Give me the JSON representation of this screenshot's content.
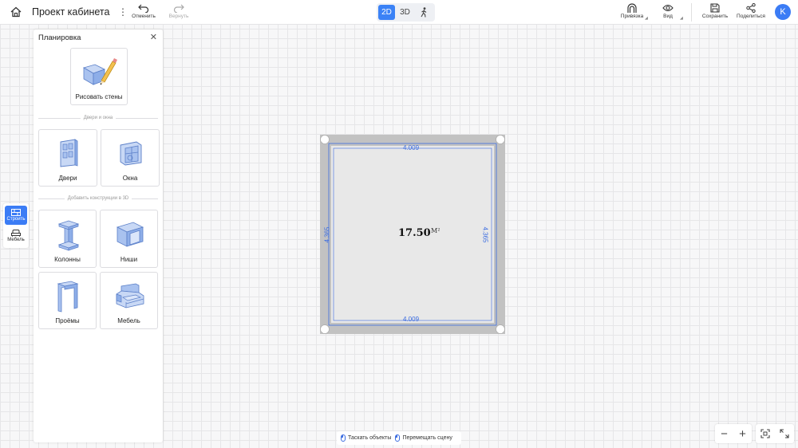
{
  "header": {
    "project_title": "Проект кабинета",
    "undo_label": "Отменить",
    "redo_label": "Вернуть",
    "modes": [
      "2D",
      "3D"
    ],
    "active_mode": "2D",
    "snap_label": "Привязка",
    "view_label": "Вид",
    "save_label": "Сохранить",
    "share_label": "Поделиться",
    "avatar_letter": "K",
    "accent_color": "#3b82f6"
  },
  "left_rail": {
    "build_label": "Строить",
    "furniture_label": "Мебель"
  },
  "panel": {
    "title": "Планировка",
    "draw_walls_label": "Рисовать стены",
    "doors_windows_header": "Двери и окна",
    "doors_label": "Двери",
    "windows_label": "Окна",
    "constructions_header": "Добавить конструкции в 3D",
    "columns_label": "Колонны",
    "niches_label": "Ниши",
    "openings_label": "Проёмы",
    "furniture_label": "Мебель"
  },
  "room": {
    "width_top": "4.009",
    "width_bottom": "4.009",
    "height_left": "4.365",
    "height_right": "4.365",
    "area_value": "17.50",
    "area_unit": "M²"
  },
  "hints": {
    "drag_objects": "Таскать объекты",
    "move_scene": "Перемещать сцену"
  },
  "zoom": {
    "minus": "−",
    "plus": "+"
  }
}
